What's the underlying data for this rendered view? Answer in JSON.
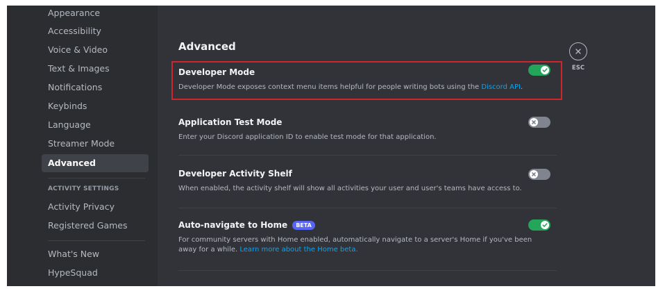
{
  "sidebar": {
    "items": [
      {
        "label": "Appearance"
      },
      {
        "label": "Accessibility"
      },
      {
        "label": "Voice & Video"
      },
      {
        "label": "Text & Images"
      },
      {
        "label": "Notifications"
      },
      {
        "label": "Keybinds"
      },
      {
        "label": "Language"
      },
      {
        "label": "Streamer Mode"
      },
      {
        "label": "Advanced"
      }
    ],
    "activity_header": "ACTIVITY SETTINGS",
    "activity_items": [
      {
        "label": "Activity Privacy"
      },
      {
        "label": "Registered Games"
      }
    ],
    "bottom_items": [
      {
        "label": "What's New"
      },
      {
        "label": "HypeSquad"
      }
    ],
    "active_item": "Advanced"
  },
  "main": {
    "title": "Advanced",
    "settings": [
      {
        "title": "Developer Mode",
        "desc_prefix": "Developer Mode exposes context menu items helpful for people writing bots using the ",
        "desc_link": "Discord API",
        "desc_suffix": ".",
        "enabled": true
      },
      {
        "title": "Application Test Mode",
        "desc": "Enter your Discord application ID to enable test mode for that application.",
        "enabled": false
      },
      {
        "title": "Developer Activity Shelf",
        "desc": "When enabled, the activity shelf will show all activities your user and user's teams have access to.",
        "enabled": false
      },
      {
        "title": "Auto-navigate to Home",
        "badge": "BETA",
        "desc_prefix": "For community servers with Home enabled, automatically navigate to a server's Home if you've been away for a while. ",
        "desc_link": "Learn more about the Home beta.",
        "enabled": true
      }
    ]
  },
  "close": {
    "label": "ESC"
  },
  "colors": {
    "sidebar_bg": "#2b2d31",
    "main_bg": "#313338",
    "toggle_on": "#23a55a",
    "toggle_off": "#80848e",
    "link": "#00a8fc",
    "beta_badge": "#5865f2",
    "highlight_border": "#d0262b"
  },
  "icons": {
    "toggle_on": "check-icon",
    "toggle_off": "x-icon",
    "close": "close-icon"
  }
}
